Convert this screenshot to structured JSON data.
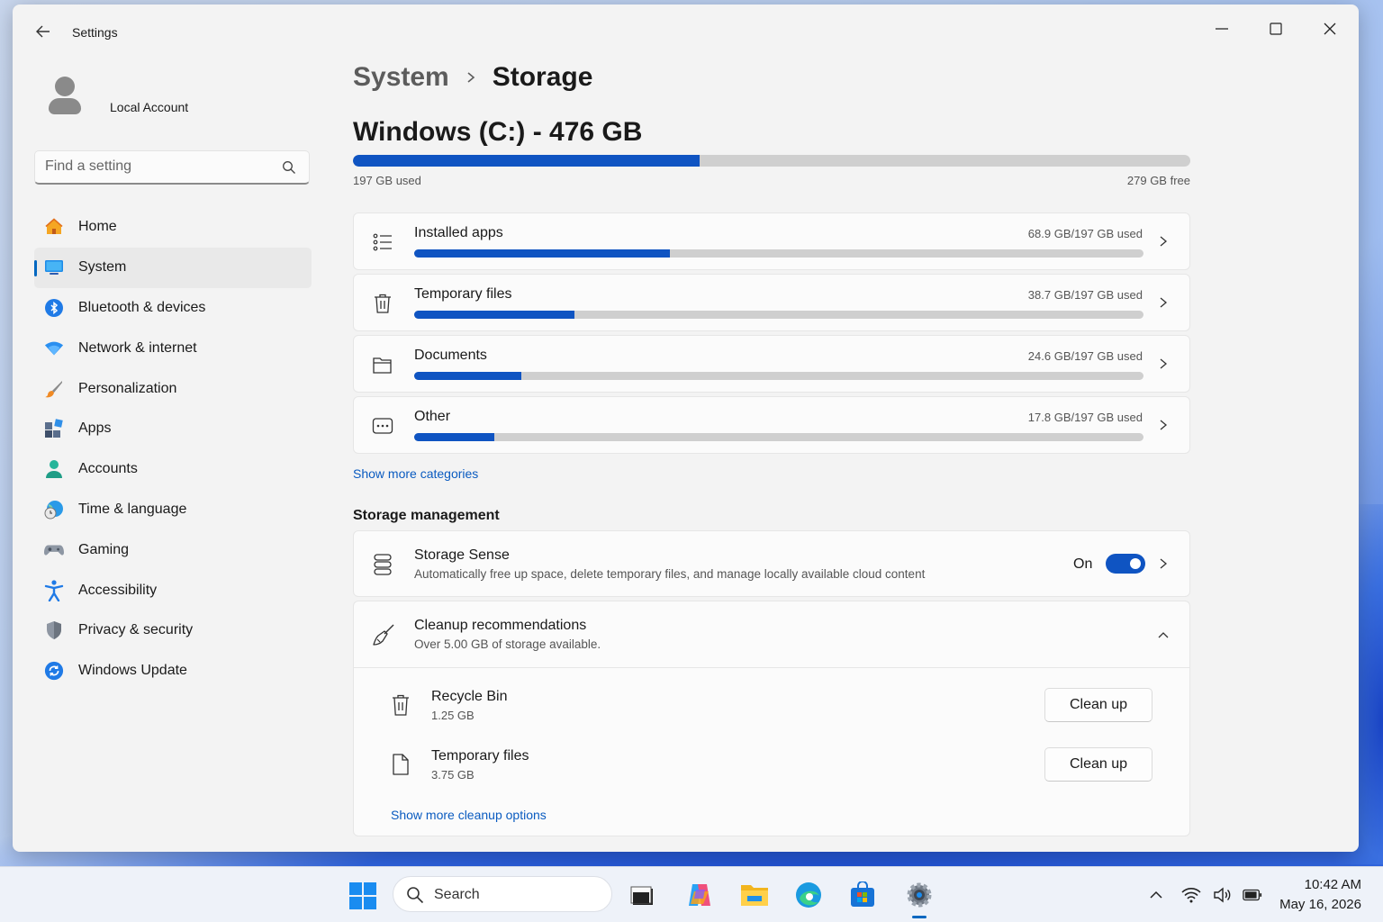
{
  "window": {
    "title": "Settings",
    "controls": {
      "minimize": "minimize-icon",
      "maximize": "maximize-icon",
      "close": "close-icon"
    }
  },
  "account": {
    "name": "Local Account"
  },
  "search": {
    "placeholder": "Find a setting"
  },
  "sidebar": {
    "items": [
      {
        "label": "Home",
        "icon": "home-icon",
        "active": false
      },
      {
        "label": "System",
        "icon": "system-icon",
        "active": true
      },
      {
        "label": "Bluetooth & devices",
        "icon": "bluetooth-icon",
        "active": false
      },
      {
        "label": "Network & internet",
        "icon": "wifi-icon",
        "active": false
      },
      {
        "label": "Personalization",
        "icon": "brush-icon",
        "active": false
      },
      {
        "label": "Apps",
        "icon": "apps-icon",
        "active": false
      },
      {
        "label": "Accounts",
        "icon": "person-icon",
        "active": false
      },
      {
        "label": "Time & language",
        "icon": "globe-clock-icon",
        "active": false
      },
      {
        "label": "Gaming",
        "icon": "gamepad-icon",
        "active": false
      },
      {
        "label": "Accessibility",
        "icon": "accessibility-icon",
        "active": false
      },
      {
        "label": "Privacy & security",
        "icon": "shield-icon",
        "active": false
      },
      {
        "label": "Windows Update",
        "icon": "update-icon",
        "active": false
      }
    ]
  },
  "breadcrumb": {
    "parent": "System",
    "separator": ">",
    "current": "Storage"
  },
  "drive": {
    "title": "Windows (C:) - 476 GB",
    "used_label": "197 GB used",
    "free_label": "279 GB free",
    "used_fraction": 0.414
  },
  "categories": [
    {
      "name": "Installed apps",
      "size": "68.9 GB/197 GB used",
      "fraction": 0.35,
      "icon": "list-icon"
    },
    {
      "name": "Temporary files",
      "size": "38.7 GB/197 GB used",
      "fraction": 0.22,
      "icon": "trash-icon"
    },
    {
      "name": "Documents",
      "size": "24.6 GB/197 GB used",
      "fraction": 0.147,
      "icon": "folder-icon"
    },
    {
      "name": "Other",
      "size": "17.8 GB/197 GB used",
      "fraction": 0.11,
      "icon": "more-icon"
    }
  ],
  "show_more_categories": "Show more categories",
  "storage_management": {
    "title": "Storage management",
    "storage_sense": {
      "title": "Storage Sense",
      "description": "Automatically free up space, delete temporary files, and manage locally available cloud content",
      "state": "On",
      "enabled": true
    },
    "cleanup": {
      "title": "Cleanup recommendations",
      "subtitle": "Over 5.00 GB of storage available.",
      "items": [
        {
          "name": "Recycle Bin",
          "size": "1.25 GB",
          "button": "Clean up",
          "icon": "trash-icon"
        },
        {
          "name": "Temporary files",
          "size": "3.75 GB",
          "button": "Clean up",
          "icon": "file-icon"
        }
      ],
      "show_more": "Show more cleanup options"
    }
  },
  "taskbar": {
    "search_label": "Search",
    "apps": [
      "start-icon",
      "task-view-icon",
      "copilot-icon",
      "file-explorer-icon",
      "edge-icon",
      "store-icon",
      "settings-icon"
    ],
    "tray": [
      "chevron-up-icon",
      "wifi-icon",
      "volume-icon",
      "battery-icon"
    ],
    "time": "10:42 AM",
    "date": "May 16, 2026"
  }
}
